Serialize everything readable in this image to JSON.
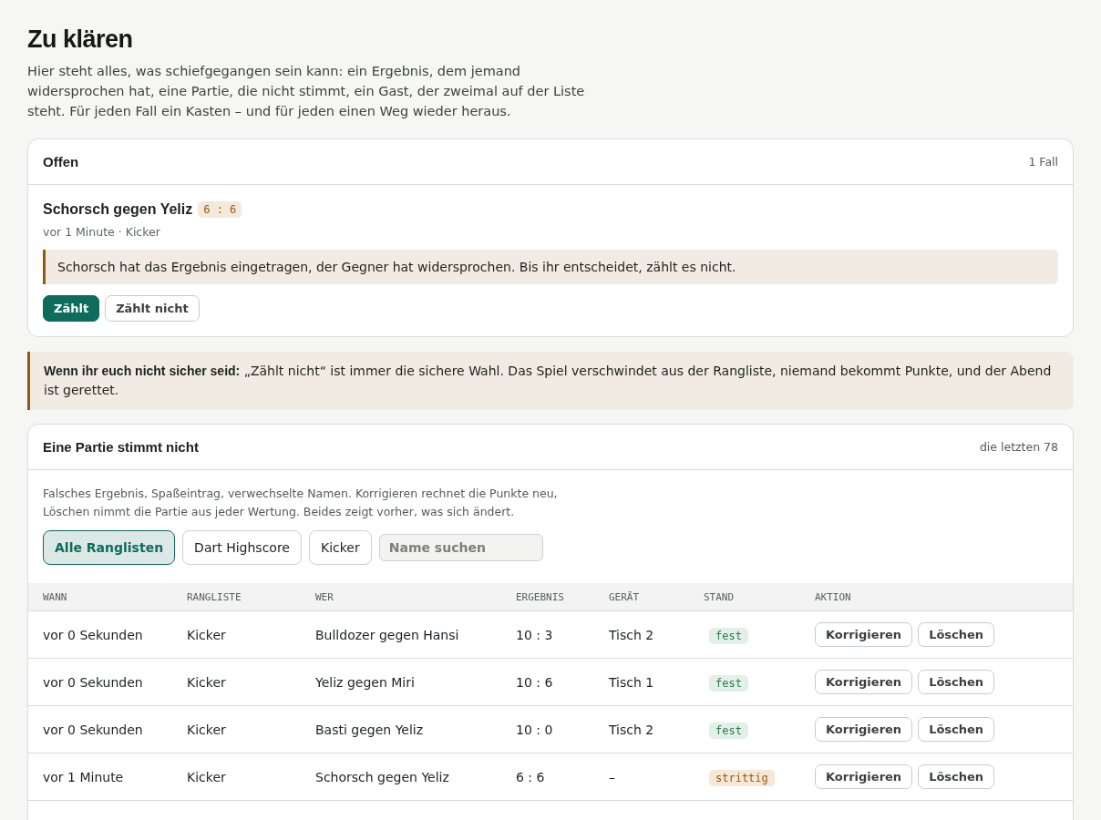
{
  "page": {
    "title": "Zu klären",
    "intro": "Hier steht alles, was schiefgegangen sein kann: ein Ergebnis, dem jemand widersprochen hat, eine Partie, die nicht stimmt, ein Gast, der zweimal auf der Liste steht. Für jeden Fall ein Kasten – und für jeden einen Weg wieder heraus."
  },
  "open_panel": {
    "title": "Offen",
    "count": "1 Fall",
    "cases": [
      {
        "title": "Schorsch gegen Yeliz",
        "score": "6 : 6",
        "meta": "vor 1 Minute · Kicker",
        "note": "Schorsch hat das Ergebnis eingetragen, der Gegner hat widersprochen. Bis ihr entscheidet, zählt es nicht.",
        "actions": [
          {
            "label": "Zählt",
            "kind": "primary"
          },
          {
            "label": "Zählt nicht",
            "kind": "secondary"
          }
        ]
      }
    ]
  },
  "hint": "**Wenn ihr euch nicht sicher seid:** „Zählt nicht“ ist immer die sichere Wahl. Das Spiel verschwindet aus der Rangliste, niemand bekommt Punkte, und der Abend ist gerettet.",
  "games_panel": {
    "title": "Eine Partie stimmt nicht",
    "count": "die letzten 78",
    "description": "Falsches Ergebnis, Spaßeintrag, verwechselte Namen. Korrigieren rechnet die Punkte neu, Löschen nimmt die Partie aus jeder Wertung. Beides zeigt vorher, was sich ändert.",
    "filters": [
      {
        "label": "Alle Ranglisten",
        "selected": true
      },
      {
        "label": "Dart Highscore",
        "selected": false
      },
      {
        "label": "Kicker",
        "selected": false
      }
    ],
    "search": {
      "placeholder": "Name suchen"
    },
    "table": {
      "columns": [
        "WANN",
        "RANGLISTE",
        "WER",
        "ERGEBNIS",
        "GERÄT",
        "STAND",
        "AKTION"
      ],
      "rows": [
        {
          "when": "vor 0 Sekunden",
          "ranking": "Kicker",
          "who": "Bulldozer gegen Hansi",
          "result": "10 : 3",
          "device": "Tisch 2",
          "status": {
            "label": "fest",
            "kind": "fixed"
          },
          "actions": [
            "Korrigieren",
            "Löschen"
          ]
        },
        {
          "when": "vor 0 Sekunden",
          "ranking": "Kicker",
          "who": "Yeliz gegen Miri",
          "result": "10 : 6",
          "device": "Tisch 1",
          "status": {
            "label": "fest",
            "kind": "fixed"
          },
          "actions": [
            "Korrigieren",
            "Löschen"
          ]
        },
        {
          "when": "vor 0 Sekunden",
          "ranking": "Kicker",
          "who": "Basti gegen Yeliz",
          "result": "10 : 0",
          "device": "Tisch 2",
          "status": {
            "label": "fest",
            "kind": "fixed"
          },
          "actions": [
            "Korrigieren",
            "Löschen"
          ]
        },
        {
          "when": "vor 1 Minute",
          "ranking": "Kicker",
          "who": "Schorsch gegen Yeliz",
          "result": "6 : 6",
          "device": "–",
          "status": {
            "label": "strittig",
            "kind": "disputed"
          },
          "actions": [
            "Korrigieren",
            "Löschen"
          ]
        }
      ]
    }
  }
}
